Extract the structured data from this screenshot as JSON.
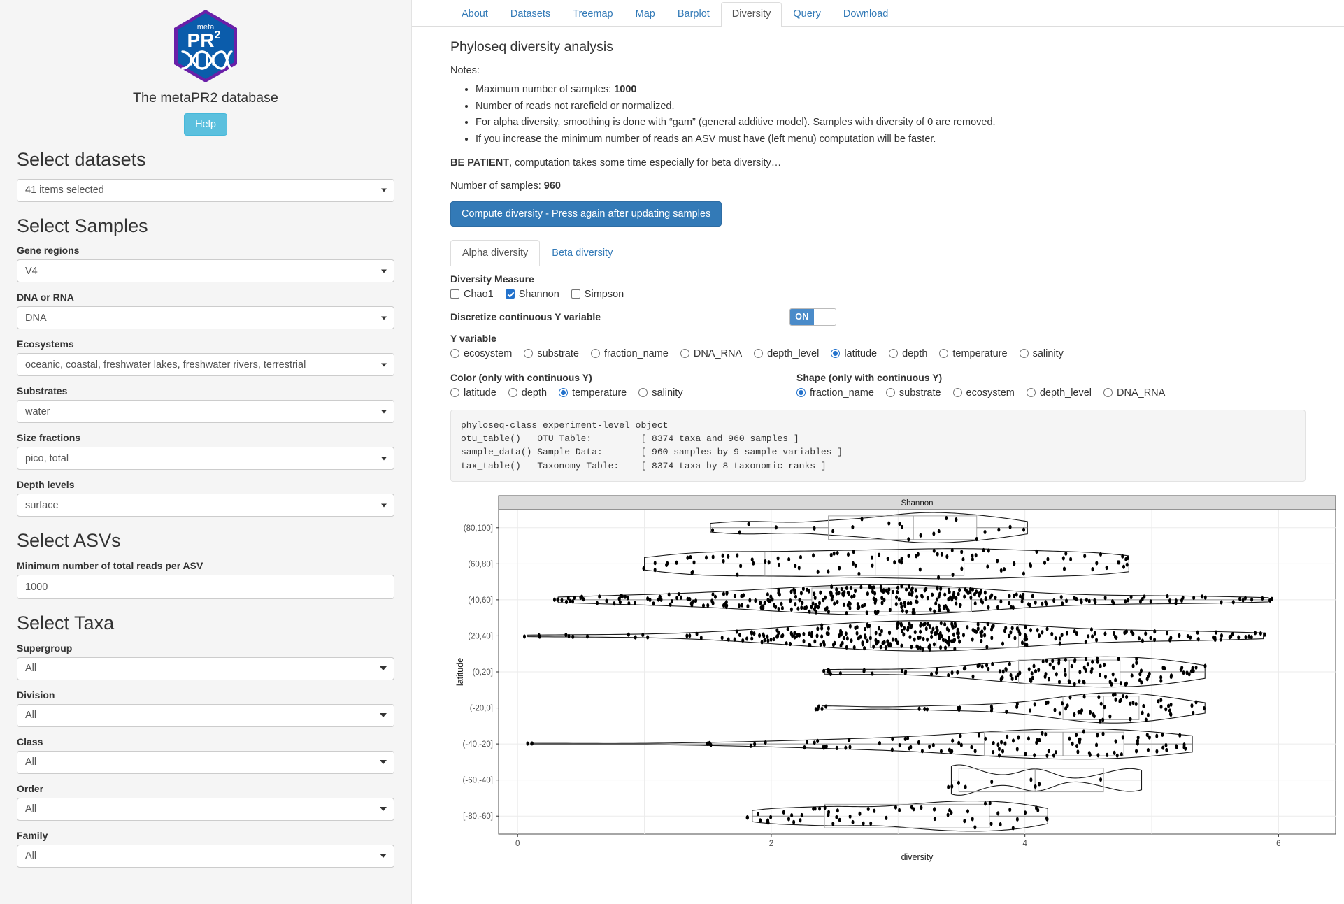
{
  "sidebar": {
    "brand_title": "The metaPR2 database",
    "logo_text_top": "meta",
    "logo_text_main": "PR",
    "logo_text_sup": "2",
    "help_label": "Help",
    "sections": [
      {
        "title": "Select datasets"
      },
      {
        "title": "Select Samples"
      },
      {
        "title": "Select ASVs"
      },
      {
        "title": "Select Taxa"
      }
    ],
    "datasets_select": {
      "label": "",
      "value": "41 items selected"
    },
    "fields": [
      {
        "label": "Gene regions",
        "value": "V4",
        "type": "select"
      },
      {
        "label": "DNA or RNA",
        "value": "DNA",
        "type": "select"
      },
      {
        "label": "Ecosystems",
        "value": "oceanic, coastal, freshwater lakes, freshwater rivers, terrestrial",
        "type": "select"
      },
      {
        "label": "Substrates",
        "value": "water",
        "type": "select"
      },
      {
        "label": "Size fractions",
        "value": "pico, total",
        "type": "select"
      },
      {
        "label": "Depth levels",
        "value": "surface",
        "type": "select"
      }
    ],
    "asv_field": {
      "label": "Minimum number of total reads per ASV",
      "value": "1000",
      "type": "text"
    },
    "taxa_fields": [
      {
        "label": "Supergroup",
        "value": "All",
        "type": "select"
      },
      {
        "label": "Division",
        "value": "All",
        "type": "select"
      },
      {
        "label": "Class",
        "value": "All",
        "type": "select"
      },
      {
        "label": "Order",
        "value": "All",
        "type": "select"
      },
      {
        "label": "Family",
        "value": "All",
        "type": "select"
      }
    ]
  },
  "nav": {
    "tabs": [
      {
        "label": "About",
        "active": false
      },
      {
        "label": "Datasets",
        "active": false
      },
      {
        "label": "Treemap",
        "active": false
      },
      {
        "label": "Map",
        "active": false
      },
      {
        "label": "Barplot",
        "active": false
      },
      {
        "label": "Diversity",
        "active": true
      },
      {
        "label": "Query",
        "active": false
      },
      {
        "label": "Download",
        "active": false
      }
    ]
  },
  "main": {
    "page_title": "Phyloseq diversity analysis",
    "notes_label": "Notes:",
    "notes": [
      {
        "pre": "Maximum number of samples: ",
        "strong": "1000",
        "post": ""
      },
      {
        "pre": "Number of reads not rarefield or normalized.",
        "strong": "",
        "post": ""
      },
      {
        "pre": "For alpha diversity, smoothing is done with “gam” (general additive model). Samples with diversity of 0 are removed.",
        "strong": "",
        "post": ""
      },
      {
        "pre": "If you increase the minimum number of reads an ASV must have (left menu) computation will be faster.",
        "strong": "",
        "post": ""
      }
    ],
    "patient_strong": "BE PATIENT",
    "patient_rest": ", computation takes some time especially for beta diversity…",
    "nsamples_label": "Number of samples: ",
    "nsamples_value": "960",
    "compute_button": "Compute diversity - Press again after updating samples",
    "subtabs": [
      {
        "label": "Alpha diversity",
        "active": true
      },
      {
        "label": "Beta diversity",
        "active": false
      }
    ],
    "diversity_measure": {
      "label": "Diversity Measure",
      "options": [
        {
          "label": "Chao1",
          "checked": false
        },
        {
          "label": "Shannon",
          "checked": true
        },
        {
          "label": "Simpson",
          "checked": false
        }
      ]
    },
    "discretize": {
      "label": "Discretize continuous Y variable",
      "state": "ON"
    },
    "y_variable": {
      "label": "Y variable",
      "options": [
        {
          "label": "ecosystem",
          "selected": false
        },
        {
          "label": "substrate",
          "selected": false
        },
        {
          "label": "fraction_name",
          "selected": false
        },
        {
          "label": "DNA_RNA",
          "selected": false
        },
        {
          "label": "depth_level",
          "selected": false
        },
        {
          "label": "latitude",
          "selected": true
        },
        {
          "label": "depth",
          "selected": false
        },
        {
          "label": "temperature",
          "selected": false
        },
        {
          "label": "salinity",
          "selected": false
        }
      ]
    },
    "color_group": {
      "label": "Color (only with continuous Y)",
      "options": [
        {
          "label": "latitude",
          "selected": false
        },
        {
          "label": "depth",
          "selected": false
        },
        {
          "label": "temperature",
          "selected": true
        },
        {
          "label": "salinity",
          "selected": false
        }
      ]
    },
    "shape_group": {
      "label": "Shape (only with continuous Y)",
      "options": [
        {
          "label": "fraction_name",
          "selected": true
        },
        {
          "label": "substrate",
          "selected": false
        },
        {
          "label": "ecosystem",
          "selected": false
        },
        {
          "label": "depth_level",
          "selected": false
        },
        {
          "label": "DNA_RNA",
          "selected": false
        }
      ]
    },
    "code_output": "phyloseq-class experiment-level object\notu_table()   OTU Table:         [ 8374 taxa and 960 samples ]\nsample_data() Sample Data:       [ 960 samples by 9 sample variables ]\ntax_table()   Taxonomy Table:    [ 8374 taxa by 8 taxonomic ranks ]"
  },
  "chart_data": {
    "type": "violin",
    "title": "Shannon",
    "xlabel": "diversity",
    "ylabel": "latitude",
    "xlim": [
      -0.15,
      6.45
    ],
    "xticks": [
      0,
      2,
      4,
      6
    ],
    "xtick_labels": [
      "0",
      "2",
      "4",
      "6"
    ],
    "grid": true,
    "legend": "none",
    "categories": [
      "(80,100]",
      "(60,80]",
      "(40,60]",
      "(20,40]",
      "(0,20]",
      "(-20,0]",
      "(-40,-20]",
      "(-60,-40]",
      "[-80,-60]"
    ],
    "series": [
      {
        "name": "(80,100]",
        "n": 22,
        "min": 1.52,
        "q1": 2.45,
        "median": 3.12,
        "q3": 3.62,
        "max": 4.02,
        "density_peak": 3.1,
        "points": [
          1.52,
          1.72,
          1.86,
          2.02,
          2.35,
          2.48,
          2.62,
          2.75,
          2.9,
          3.02,
          3.05,
          3.12,
          3.2,
          3.28,
          3.35,
          3.42,
          3.5,
          3.58,
          3.66,
          3.78,
          3.9,
          4.0
        ]
      },
      {
        "name": "(60,80]",
        "n": 96,
        "min": 1.0,
        "q1": 1.95,
        "median": 2.82,
        "q3": 3.52,
        "max": 4.82,
        "density_peak": 2.7,
        "points": [
          1.0,
          1.05,
          1.12,
          1.18,
          1.2,
          1.25,
          1.3,
          1.35,
          1.38,
          1.42,
          1.45,
          1.5,
          1.55,
          1.58,
          1.62,
          1.65,
          1.7,
          1.75,
          1.8,
          1.85,
          1.9,
          1.95,
          2.0,
          2.05,
          2.1,
          2.12,
          2.18,
          2.22,
          2.25,
          2.3,
          2.35,
          2.4,
          2.42,
          2.48,
          2.5,
          2.55,
          2.6,
          2.62,
          2.68,
          2.7,
          2.75,
          2.8,
          2.82,
          2.88,
          2.9,
          2.95,
          3.0,
          3.02,
          3.05,
          3.1,
          3.12,
          3.18,
          3.2,
          3.25,
          3.3,
          3.32,
          3.35,
          3.4,
          3.42,
          3.45,
          3.5,
          3.52,
          3.55,
          3.6,
          3.62,
          3.65,
          3.7,
          3.72,
          3.75,
          3.8,
          3.82,
          3.85,
          3.9,
          3.95,
          4.0,
          4.02,
          4.08,
          4.1,
          4.15,
          4.2,
          4.25,
          4.3,
          4.35,
          4.4,
          4.45,
          4.5,
          4.55,
          4.6,
          4.62,
          4.68,
          4.7,
          4.72,
          4.75,
          4.78,
          4.8,
          4.82
        ]
      },
      {
        "name": "(40,60]",
        "n": 330,
        "min": 0.32,
        "q1": 2.32,
        "median": 2.95,
        "q3": 3.58,
        "max": 5.92,
        "density_peak": 2.9,
        "points": [
          0.32,
          0.35,
          0.42,
          0.5,
          0.62,
          0.72,
          0.8,
          0.9,
          1.0,
          1.08,
          1.15,
          1.22,
          1.3,
          1.38,
          1.45,
          1.5,
          1.58,
          1.62,
          1.68,
          1.72,
          1.78,
          1.82,
          1.88,
          1.92,
          1.95,
          2.0,
          2.02,
          2.08,
          2.1,
          2.15,
          2.18,
          2.2,
          2.25,
          2.28,
          2.3,
          2.32,
          2.35,
          2.38,
          2.4,
          2.42,
          2.45,
          2.48,
          2.5,
          2.52,
          2.55,
          2.58,
          2.6,
          2.62,
          2.65,
          2.68,
          2.7,
          2.72,
          2.75,
          2.78,
          2.8,
          2.82,
          2.85,
          2.88,
          2.9,
          2.92,
          2.95,
          2.98,
          3.0,
          3.02,
          3.05,
          3.08,
          3.1,
          3.12,
          3.15,
          3.18,
          3.2,
          3.22,
          3.25,
          3.28,
          3.3,
          3.32,
          3.35,
          3.38,
          3.4,
          3.42,
          3.45,
          3.48,
          3.5,
          3.52,
          3.55,
          3.58,
          3.6,
          3.65,
          3.7,
          3.75,
          3.8,
          3.85,
          3.9,
          3.95,
          4.0,
          4.1,
          4.2,
          4.3,
          4.4,
          4.5,
          4.6,
          4.7,
          4.8,
          4.9,
          5.0,
          5.1,
          5.2,
          5.3,
          5.4,
          5.5,
          5.6,
          5.7,
          5.8,
          5.9
        ]
      },
      {
        "name": "(20,40]",
        "n": 300,
        "min": 0.08,
        "q1": 2.78,
        "median": 3.3,
        "q3": 3.95,
        "max": 5.88,
        "density_peak": 3.2,
        "points": [
          0.08,
          0.45,
          0.95,
          1.35,
          1.7,
          1.78,
          1.85,
          1.92,
          2.0,
          2.08,
          2.12,
          2.18,
          2.22,
          2.28,
          2.32,
          2.38,
          2.42,
          2.45,
          2.5,
          2.55,
          2.6,
          2.62,
          2.68,
          2.7,
          2.75,
          2.78,
          2.8,
          2.85,
          2.88,
          2.9,
          2.95,
          2.98,
          3.0,
          3.05,
          3.08,
          3.1,
          3.15,
          3.18,
          3.2,
          3.22,
          3.25,
          3.28,
          3.3,
          3.32,
          3.35,
          3.38,
          3.4,
          3.42,
          3.45,
          3.48,
          3.5,
          3.55,
          3.58,
          3.6,
          3.62,
          3.68,
          3.7,
          3.75,
          3.8,
          3.85,
          3.9,
          3.95,
          4.0,
          4.05,
          4.1,
          4.15,
          4.2,
          4.3,
          4.4,
          4.5,
          4.6,
          4.7,
          4.8,
          4.9,
          5.0,
          5.1,
          5.2,
          5.3,
          5.4,
          5.5,
          5.6,
          5.7,
          5.8,
          5.88
        ]
      },
      {
        "name": "(0,20]",
        "n": 120,
        "min": 2.42,
        "q1": 3.95,
        "median": 4.35,
        "q3": 4.75,
        "max": 5.42,
        "density_peak": 4.5,
        "points": [
          2.42,
          2.5,
          2.78,
          3.05,
          3.3,
          3.42,
          3.55,
          3.62,
          3.7,
          3.78,
          3.85,
          3.9,
          3.95,
          4.0,
          4.05,
          4.1,
          4.15,
          4.2,
          4.25,
          4.3,
          4.32,
          4.38,
          4.4,
          4.45,
          4.5,
          4.52,
          4.58,
          4.6,
          4.65,
          4.7,
          4.72,
          4.78,
          4.8,
          4.85,
          4.88,
          4.9,
          4.95,
          5.0,
          5.05,
          5.1,
          5.15,
          5.2,
          5.25,
          5.3,
          5.35,
          5.4
        ]
      },
      {
        "name": "(-20,0]",
        "n": 70,
        "min": 2.4,
        "q1": 4.3,
        "median": 4.62,
        "q3": 4.9,
        "max": 5.42,
        "density_peak": 4.6,
        "points": [
          2.4,
          2.42,
          3.2,
          3.45,
          3.7,
          3.9,
          4.05,
          4.15,
          4.25,
          4.3,
          4.35,
          4.4,
          4.45,
          4.5,
          4.55,
          4.6,
          4.62,
          4.65,
          4.7,
          4.72,
          4.75,
          4.8,
          4.85,
          4.9,
          4.95,
          5.0,
          5.05,
          5.1,
          5.15,
          5.2,
          5.3,
          5.4
        ]
      },
      {
        "name": "(-40,-20]",
        "n": 110,
        "min": 0.1,
        "q1": 3.68,
        "median": 4.3,
        "q3": 4.78,
        "max": 5.32,
        "density_peak": 4.35,
        "points": [
          0.1,
          1.48,
          1.88,
          2.35,
          2.42,
          2.5,
          2.62,
          2.9,
          3.0,
          3.12,
          3.25,
          3.35,
          3.45,
          3.52,
          3.6,
          3.68,
          3.72,
          3.8,
          3.85,
          3.9,
          3.95,
          4.0,
          4.05,
          4.1,
          4.15,
          4.2,
          4.25,
          4.3,
          4.35,
          4.4,
          4.45,
          4.5,
          4.55,
          4.6,
          4.65,
          4.7,
          4.75,
          4.8,
          4.85,
          4.9,
          4.95,
          5.0,
          5.05,
          5.1,
          5.15,
          5.2,
          5.25,
          5.3
        ]
      },
      {
        "name": "(-60,-40]",
        "n": 9,
        "min": 3.42,
        "q1": 3.48,
        "median": 4.08,
        "q3": 4.62,
        "max": 4.92,
        "density_peak": 4.0,
        "points": [
          3.42,
          3.45,
          3.48,
          3.52,
          3.72,
          4.05,
          4.08,
          4.12,
          4.62,
          4.78,
          4.88,
          4.9
        ]
      },
      {
        "name": "[-80,-60]",
        "n": 60,
        "min": 1.85,
        "q1": 2.42,
        "median": 3.15,
        "q3": 3.72,
        "max": 4.18,
        "density_peak": 3.3,
        "points": [
          1.85,
          1.9,
          1.95,
          2.0,
          2.1,
          2.18,
          2.25,
          2.35,
          2.42,
          2.45,
          2.5,
          2.55,
          2.62,
          2.7,
          2.78,
          2.85,
          2.92,
          3.0,
          3.05,
          3.1,
          3.15,
          3.2,
          3.25,
          3.3,
          3.32,
          3.38,
          3.4,
          3.45,
          3.5,
          3.55,
          3.58,
          3.62,
          3.65,
          3.7,
          3.72,
          3.78,
          3.82,
          3.85,
          3.9,
          3.95,
          4.0,
          4.05,
          4.1,
          4.15,
          4.18
        ]
      }
    ]
  }
}
